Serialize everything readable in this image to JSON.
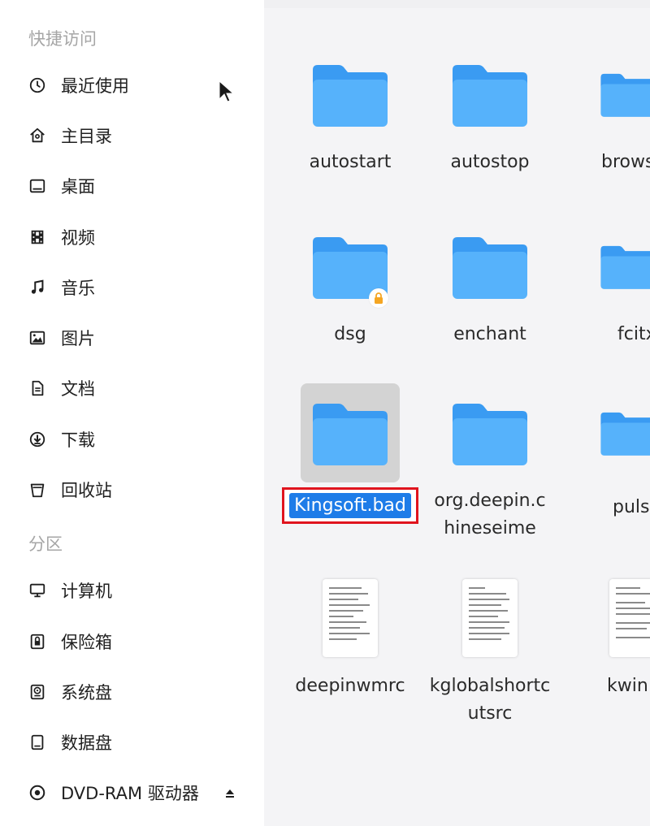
{
  "sidebar": {
    "quick_access_header": "快捷访问",
    "quick_access": [
      {
        "label": "最近使用",
        "icon": "clock-icon"
      },
      {
        "label": "主目录",
        "icon": "home-icon"
      },
      {
        "label": "桌面",
        "icon": "desktop-icon"
      },
      {
        "label": "视频",
        "icon": "film-icon"
      },
      {
        "label": "音乐",
        "icon": "music-note-icon"
      },
      {
        "label": "图片",
        "icon": "image-icon"
      },
      {
        "label": "文档",
        "icon": "document-icon"
      },
      {
        "label": "下载",
        "icon": "download-icon"
      },
      {
        "label": "回收站",
        "icon": "trash-icon"
      }
    ],
    "partitions_header": "分区",
    "partitions": [
      {
        "label": "计算机",
        "icon": "monitor-icon"
      },
      {
        "label": "保险箱",
        "icon": "safe-icon"
      },
      {
        "label": "系统盘",
        "icon": "system-disk-icon"
      },
      {
        "label": "数据盘",
        "icon": "data-disk-icon"
      },
      {
        "label": "DVD-RAM 驱动器",
        "icon": "disc-icon"
      }
    ]
  },
  "files": {
    "row1": [
      "autostart",
      "autostop",
      "brows"
    ],
    "row2": [
      "dsg",
      "enchant",
      "fcitx"
    ],
    "row3": {
      "renaming": "Kingsoft.bad",
      "second": "org.deepin.chineseime",
      "third": "puls"
    },
    "row4": [
      "deepinwmrc",
      "kglobalshortcutsrc",
      "kwin"
    ]
  },
  "colors": {
    "folder_top": "#3a9bf2",
    "folder_body": "#56b2fb",
    "selection": "#1e7ce8",
    "highlight_border": "#e0141e",
    "lock_badge": "#f5a623"
  }
}
